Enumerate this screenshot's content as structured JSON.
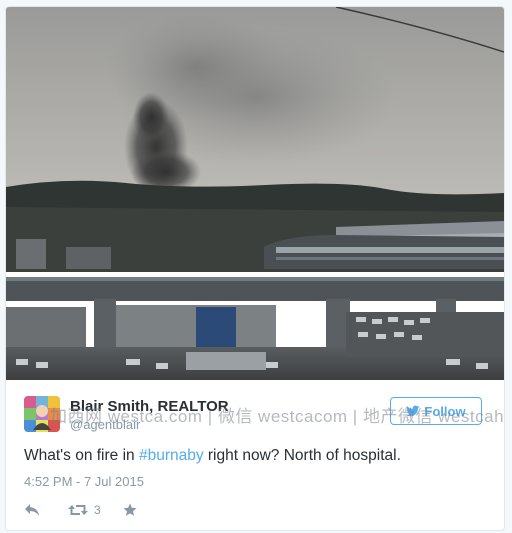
{
  "tweet": {
    "author_name": "Blair Smith, REALTOR",
    "author_handle": "@agentblair",
    "follow_label": "Follow",
    "text_before": "What's on fire in ",
    "hashtag": "#burnaby",
    "text_after": " right now? North of hospital.",
    "timestamp": "4:52 PM - 7 Jul 2015",
    "retweet_count": "3"
  },
  "watermark": "加西网 westca.com | 微信 westcacom | 地产微信 westcahouse",
  "colors": {
    "link_blue": "#55acee",
    "text_dark": "#292f33",
    "text_gray": "#8899a6"
  }
}
